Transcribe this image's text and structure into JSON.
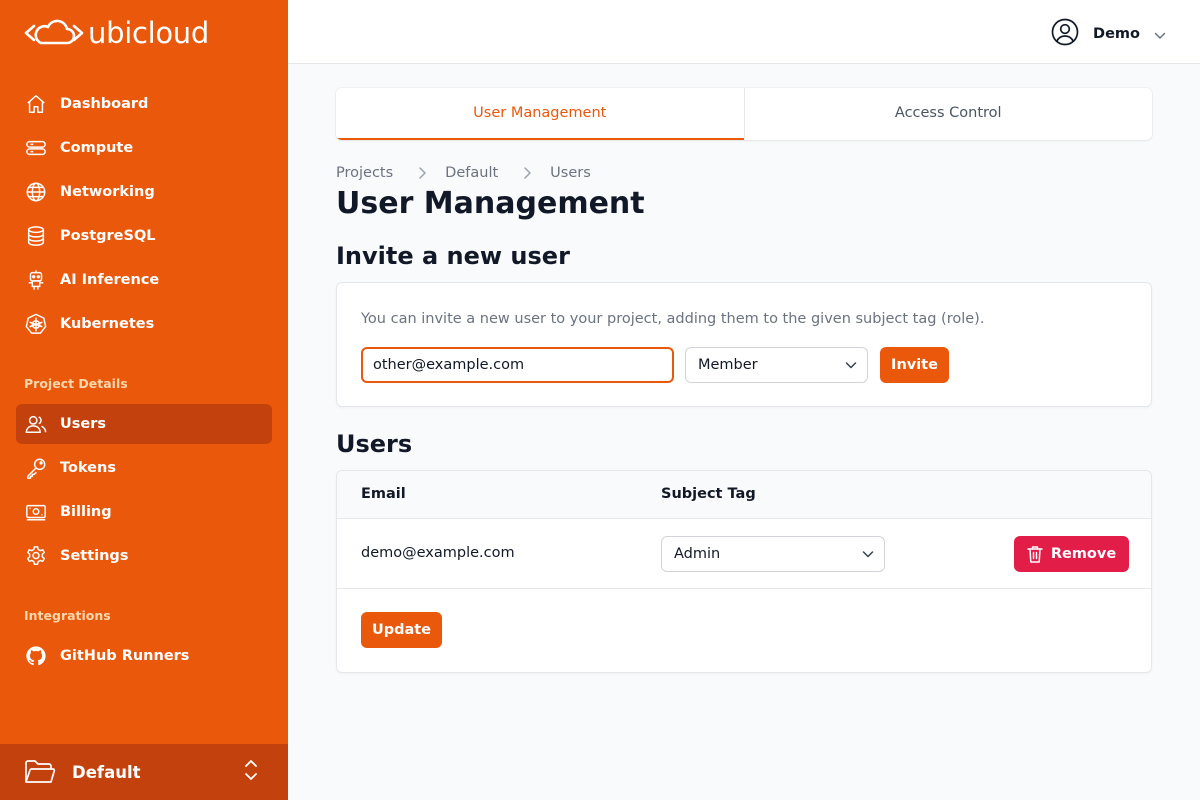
{
  "brand": {
    "name": "ubicloud",
    "accent": "#ea580c",
    "accent_dark": "#c2410c",
    "danger": "#e11d48"
  },
  "sidebar": {
    "items": [
      {
        "label": "Dashboard",
        "icon": "home-icon"
      },
      {
        "label": "Compute",
        "icon": "server-icon"
      },
      {
        "label": "Networking",
        "icon": "globe-icon"
      },
      {
        "label": "PostgreSQL",
        "icon": "database-icon"
      },
      {
        "label": "AI Inference",
        "icon": "robot-icon"
      },
      {
        "label": "Kubernetes",
        "icon": "kubernetes-icon"
      }
    ],
    "project_section": {
      "title": "Project Details",
      "items": [
        {
          "label": "Users",
          "icon": "users-icon",
          "active": true
        },
        {
          "label": "Tokens",
          "icon": "key-icon"
        },
        {
          "label": "Billing",
          "icon": "banknote-icon"
        },
        {
          "label": "Settings",
          "icon": "gear-icon"
        }
      ]
    },
    "integrations_section": {
      "title": "Integrations",
      "items": [
        {
          "label": "GitHub Runners",
          "icon": "github-icon"
        }
      ]
    },
    "project_switcher": {
      "label": "Default",
      "icon": "folder-icon"
    }
  },
  "header": {
    "user_name": "Demo",
    "icon": "user-circle-icon"
  },
  "tabs": [
    {
      "label": "User Management",
      "active": true
    },
    {
      "label": "Access Control",
      "active": false
    }
  ],
  "breadcrumb": [
    "Projects",
    "Default",
    "Users"
  ],
  "page_title": "User Management",
  "invite": {
    "title": "Invite a new user",
    "description": "You can invite a new user to your project, adding them to the given subject tag (role).",
    "email_value": "other@example.com",
    "role_selected": "Member",
    "invite_label": "Invite"
  },
  "users": {
    "title": "Users",
    "columns": [
      "Email",
      "Subject Tag"
    ],
    "rows": [
      {
        "email": "demo@example.com",
        "subject_tag": "Admin",
        "remove_label": "Remove"
      }
    ],
    "update_label": "Update"
  }
}
